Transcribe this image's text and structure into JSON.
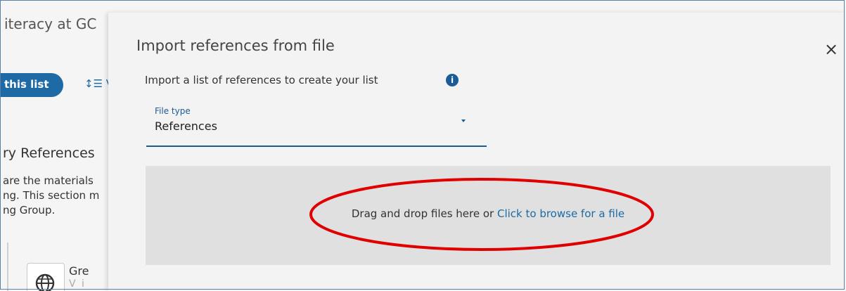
{
  "background": {
    "page_title": "iteracy at GC",
    "action_button": "this list",
    "sort_label": "↕☰ V",
    "section_heading": "ry References",
    "section_desc_lines": [
      "are the materials",
      "ng. This section m",
      "ng Group."
    ],
    "item_title": "Gre",
    "item_subtitle": "V i",
    "icons": {
      "globe": "globe-icon"
    }
  },
  "modal": {
    "title": "Import references from file",
    "close_icon": "×",
    "subtitle": "Import a list of references to create your list",
    "info_icon": "i",
    "file_type": {
      "label": "File type",
      "value": "References"
    },
    "dropzone": {
      "text": "Drag and drop files here or ",
      "link": "Click to browse for a file"
    }
  },
  "colors": {
    "accent": "#1d5b96",
    "link": "#1d6aa5",
    "annotation": "#e00000",
    "dropzone_bg": "#e0e0e0"
  }
}
